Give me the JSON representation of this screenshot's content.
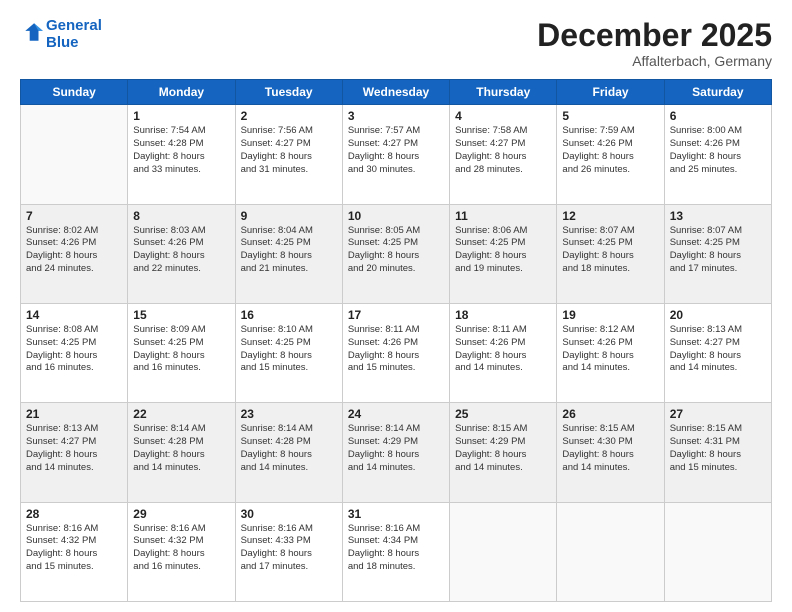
{
  "header": {
    "logo_line1": "General",
    "logo_line2": "Blue",
    "month": "December 2025",
    "location": "Affalterbach, Germany"
  },
  "days_of_week": [
    "Sunday",
    "Monday",
    "Tuesday",
    "Wednesday",
    "Thursday",
    "Friday",
    "Saturday"
  ],
  "weeks": [
    {
      "shaded": false,
      "days": [
        {
          "num": "",
          "info": ""
        },
        {
          "num": "1",
          "info": "Sunrise: 7:54 AM\nSunset: 4:28 PM\nDaylight: 8 hours\nand 33 minutes."
        },
        {
          "num": "2",
          "info": "Sunrise: 7:56 AM\nSunset: 4:27 PM\nDaylight: 8 hours\nand 31 minutes."
        },
        {
          "num": "3",
          "info": "Sunrise: 7:57 AM\nSunset: 4:27 PM\nDaylight: 8 hours\nand 30 minutes."
        },
        {
          "num": "4",
          "info": "Sunrise: 7:58 AM\nSunset: 4:27 PM\nDaylight: 8 hours\nand 28 minutes."
        },
        {
          "num": "5",
          "info": "Sunrise: 7:59 AM\nSunset: 4:26 PM\nDaylight: 8 hours\nand 26 minutes."
        },
        {
          "num": "6",
          "info": "Sunrise: 8:00 AM\nSunset: 4:26 PM\nDaylight: 8 hours\nand 25 minutes."
        }
      ]
    },
    {
      "shaded": true,
      "days": [
        {
          "num": "7",
          "info": "Sunrise: 8:02 AM\nSunset: 4:26 PM\nDaylight: 8 hours\nand 24 minutes."
        },
        {
          "num": "8",
          "info": "Sunrise: 8:03 AM\nSunset: 4:26 PM\nDaylight: 8 hours\nand 22 minutes."
        },
        {
          "num": "9",
          "info": "Sunrise: 8:04 AM\nSunset: 4:25 PM\nDaylight: 8 hours\nand 21 minutes."
        },
        {
          "num": "10",
          "info": "Sunrise: 8:05 AM\nSunset: 4:25 PM\nDaylight: 8 hours\nand 20 minutes."
        },
        {
          "num": "11",
          "info": "Sunrise: 8:06 AM\nSunset: 4:25 PM\nDaylight: 8 hours\nand 19 minutes."
        },
        {
          "num": "12",
          "info": "Sunrise: 8:07 AM\nSunset: 4:25 PM\nDaylight: 8 hours\nand 18 minutes."
        },
        {
          "num": "13",
          "info": "Sunrise: 8:07 AM\nSunset: 4:25 PM\nDaylight: 8 hours\nand 17 minutes."
        }
      ]
    },
    {
      "shaded": false,
      "days": [
        {
          "num": "14",
          "info": "Sunrise: 8:08 AM\nSunset: 4:25 PM\nDaylight: 8 hours\nand 16 minutes."
        },
        {
          "num": "15",
          "info": "Sunrise: 8:09 AM\nSunset: 4:25 PM\nDaylight: 8 hours\nand 16 minutes."
        },
        {
          "num": "16",
          "info": "Sunrise: 8:10 AM\nSunset: 4:25 PM\nDaylight: 8 hours\nand 15 minutes."
        },
        {
          "num": "17",
          "info": "Sunrise: 8:11 AM\nSunset: 4:26 PM\nDaylight: 8 hours\nand 15 minutes."
        },
        {
          "num": "18",
          "info": "Sunrise: 8:11 AM\nSunset: 4:26 PM\nDaylight: 8 hours\nand 14 minutes."
        },
        {
          "num": "19",
          "info": "Sunrise: 8:12 AM\nSunset: 4:26 PM\nDaylight: 8 hours\nand 14 minutes."
        },
        {
          "num": "20",
          "info": "Sunrise: 8:13 AM\nSunset: 4:27 PM\nDaylight: 8 hours\nand 14 minutes."
        }
      ]
    },
    {
      "shaded": true,
      "days": [
        {
          "num": "21",
          "info": "Sunrise: 8:13 AM\nSunset: 4:27 PM\nDaylight: 8 hours\nand 14 minutes."
        },
        {
          "num": "22",
          "info": "Sunrise: 8:14 AM\nSunset: 4:28 PM\nDaylight: 8 hours\nand 14 minutes."
        },
        {
          "num": "23",
          "info": "Sunrise: 8:14 AM\nSunset: 4:28 PM\nDaylight: 8 hours\nand 14 minutes."
        },
        {
          "num": "24",
          "info": "Sunrise: 8:14 AM\nSunset: 4:29 PM\nDaylight: 8 hours\nand 14 minutes."
        },
        {
          "num": "25",
          "info": "Sunrise: 8:15 AM\nSunset: 4:29 PM\nDaylight: 8 hours\nand 14 minutes."
        },
        {
          "num": "26",
          "info": "Sunrise: 8:15 AM\nSunset: 4:30 PM\nDaylight: 8 hours\nand 14 minutes."
        },
        {
          "num": "27",
          "info": "Sunrise: 8:15 AM\nSunset: 4:31 PM\nDaylight: 8 hours\nand 15 minutes."
        }
      ]
    },
    {
      "shaded": false,
      "days": [
        {
          "num": "28",
          "info": "Sunrise: 8:16 AM\nSunset: 4:32 PM\nDaylight: 8 hours\nand 15 minutes."
        },
        {
          "num": "29",
          "info": "Sunrise: 8:16 AM\nSunset: 4:32 PM\nDaylight: 8 hours\nand 16 minutes."
        },
        {
          "num": "30",
          "info": "Sunrise: 8:16 AM\nSunset: 4:33 PM\nDaylight: 8 hours\nand 17 minutes."
        },
        {
          "num": "31",
          "info": "Sunrise: 8:16 AM\nSunset: 4:34 PM\nDaylight: 8 hours\nand 18 minutes."
        },
        {
          "num": "",
          "info": ""
        },
        {
          "num": "",
          "info": ""
        },
        {
          "num": "",
          "info": ""
        }
      ]
    }
  ]
}
